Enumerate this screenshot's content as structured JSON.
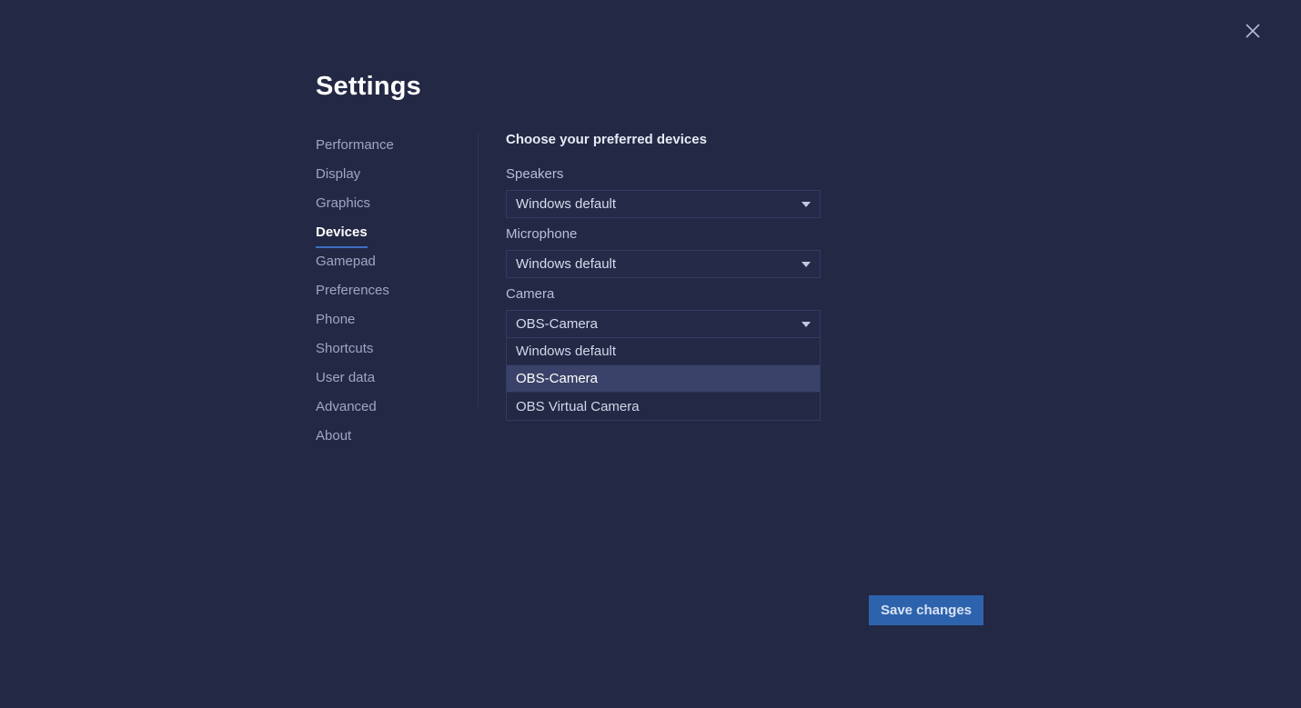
{
  "dialog": {
    "title": "Settings",
    "close_icon": "close-icon"
  },
  "sidebar": {
    "items": [
      {
        "label": "Performance",
        "active": false
      },
      {
        "label": "Display",
        "active": false
      },
      {
        "label": "Graphics",
        "active": false
      },
      {
        "label": "Devices",
        "active": true
      },
      {
        "label": "Gamepad",
        "active": false
      },
      {
        "label": "Preferences",
        "active": false
      },
      {
        "label": "Phone",
        "active": false
      },
      {
        "label": "Shortcuts",
        "active": false
      },
      {
        "label": "User data",
        "active": false
      },
      {
        "label": "Advanced",
        "active": false
      },
      {
        "label": "About",
        "active": false
      }
    ]
  },
  "content": {
    "heading": "Choose your preferred devices",
    "speakers": {
      "label": "Speakers",
      "value": "Windows default",
      "caret_icon": "chevron-down-icon"
    },
    "microphone": {
      "label": "Microphone",
      "value": "Windows default",
      "caret_icon": "chevron-down-icon"
    },
    "camera": {
      "label": "Camera",
      "value": "OBS-Camera",
      "caret_icon": "chevron-down-icon",
      "expanded": true,
      "options": [
        {
          "label": "Windows default",
          "selected": false
        },
        {
          "label": "OBS-Camera",
          "selected": true
        },
        {
          "label": "OBS Virtual Camera",
          "selected": false
        }
      ]
    }
  },
  "footer": {
    "save_label": "Save changes"
  },
  "colors": {
    "background": "#232845",
    "accent": "#3f6ec4",
    "save_button": "#2d63ad",
    "option_selected": "#3b4269"
  }
}
